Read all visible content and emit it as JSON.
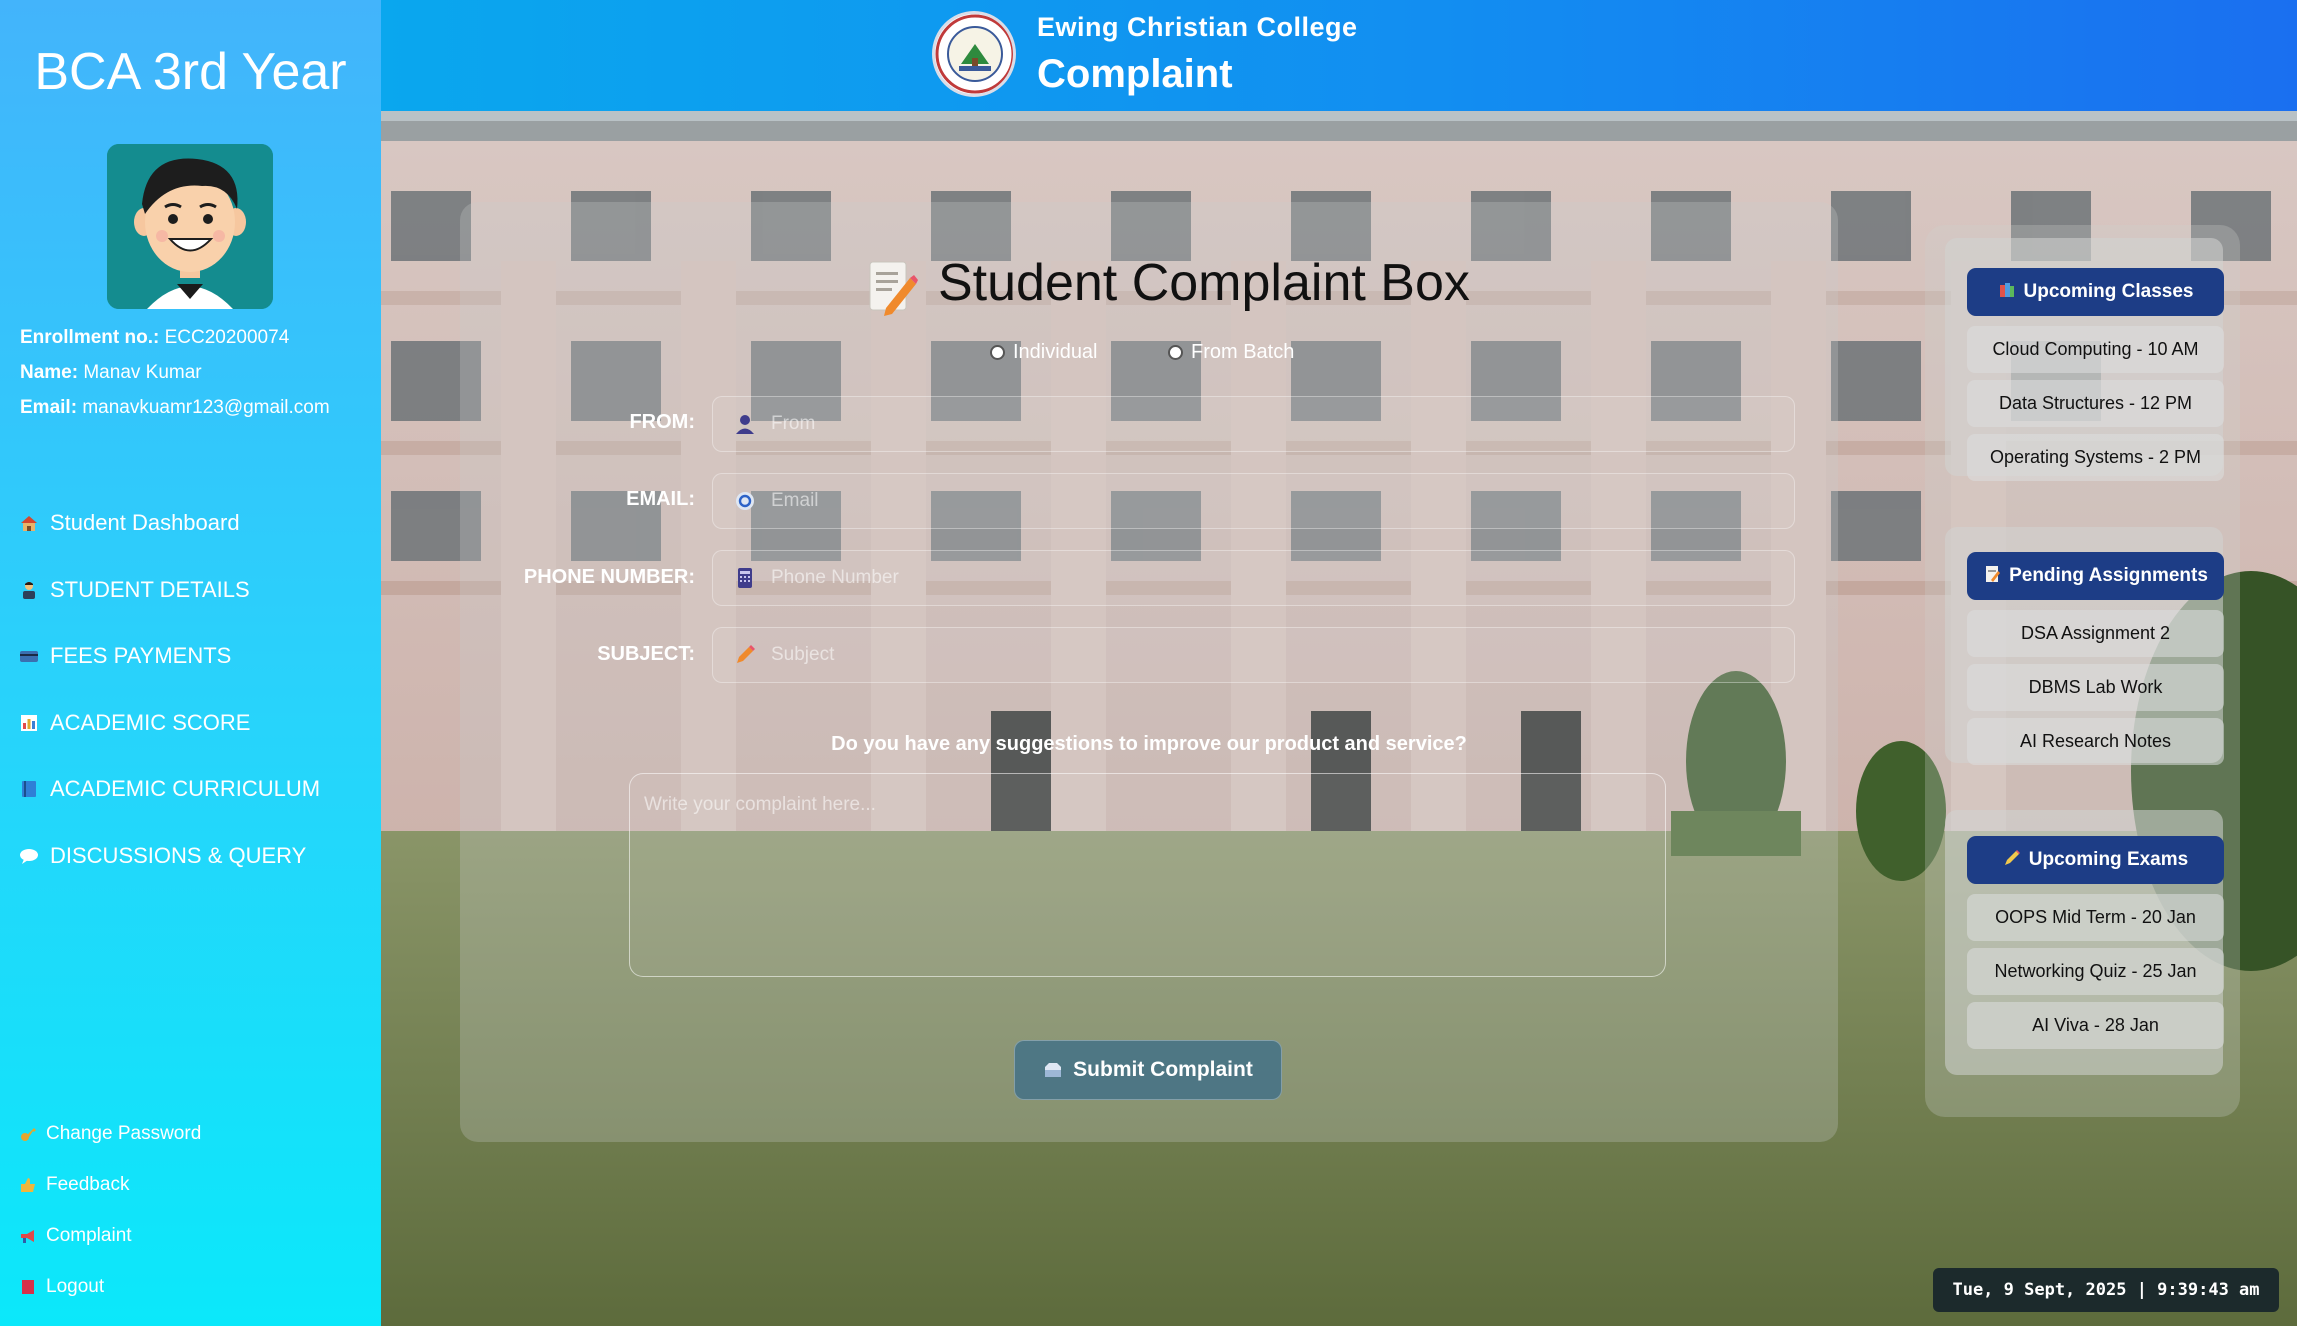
{
  "sidebar": {
    "year": "BCA 3rd Year",
    "enrollment_label": "Enrollment no.:",
    "enrollment": "ECC20200074",
    "name_label": "Name:",
    "name": "Manav Kumar",
    "email_label": "Email:",
    "email": "manavkuamr123@gmail.com",
    "nav": [
      {
        "label": "Student Dashboard",
        "icon": "house-icon"
      },
      {
        "label": "STUDENT DETAILS",
        "icon": "student-icon"
      },
      {
        "label": "FEES PAYMENTS",
        "icon": "card-icon"
      },
      {
        "label": "ACADEMIC SCORE",
        "icon": "chart-icon"
      },
      {
        "label": "ACADEMIC CURRICULUM",
        "icon": "book-icon"
      },
      {
        "label": "DISCUSSIONS & QUERY",
        "icon": "chat-icon"
      }
    ],
    "bottom_nav": [
      {
        "label": "Change Password",
        "icon": "key-icon"
      },
      {
        "label": "Feedback",
        "icon": "feedback-icon"
      },
      {
        "label": "Complaint",
        "icon": "megaphone-icon"
      },
      {
        "label": "Logout",
        "icon": "logout-icon"
      }
    ]
  },
  "header": {
    "college": "Ewing Christian College",
    "title": "Complaint"
  },
  "form": {
    "title": "Student Complaint Box",
    "radio_individual": "Individual",
    "radio_batch": "From Batch",
    "from_label": "FROM:",
    "from_placeholder": "From",
    "email_label": "EMAIL:",
    "email_placeholder": "Email",
    "phone_label": "PHONE NUMBER:",
    "phone_placeholder": "Phone Number",
    "subject_label": "SUBJECT:",
    "subject_placeholder": "Subject",
    "question": "Do you have any suggestions to improve our product and service?",
    "textarea_placeholder": "Write your complaint here...",
    "submit": "Submit Complaint"
  },
  "right": {
    "classes_title": "Upcoming Classes",
    "classes": [
      "Cloud Computing - 10 AM",
      "Data Structures - 12 PM",
      "Operating Systems - 2 PM"
    ],
    "assignments_title": "Pending Assignments",
    "assignments": [
      "DSA Assignment 2",
      "DBMS Lab Work",
      "AI Research Notes"
    ],
    "exams_title": "Upcoming Exams",
    "exams": [
      "OOPS Mid Term - 20 Jan",
      "Networking Quiz - 25 Jan",
      "AI Viva - 28 Jan"
    ]
  },
  "clock": "Tue, 9 Sept, 2025 | 9:39:43 am",
  "colors": {
    "sidebar_top": "#43b4fb",
    "sidebar_bottom": "#0be8fa",
    "header_start": "#0aa7ee",
    "header_end": "#1a6ff0",
    "card_header": "#1d3d86"
  }
}
